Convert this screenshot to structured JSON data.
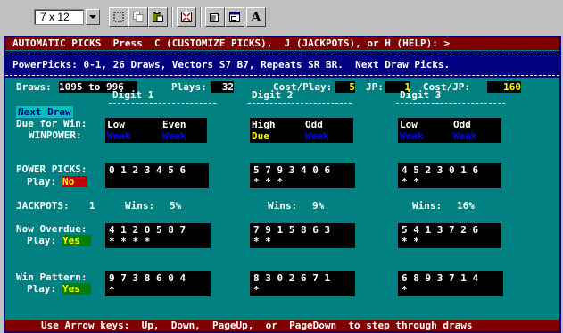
{
  "toolbar": {
    "font_size": "7 x 12",
    "letter_button": "A",
    "icons": [
      "select-icon",
      "copy-icon",
      "paste-icon",
      "fullscreen-icon",
      "properties-icon",
      "background-icon",
      "font-icon"
    ]
  },
  "header": {
    "prompt": "AUTOMATIC PICKS  Press  C (CUSTOMIZE PICKS),  J (JACKPOTS), or H (HELP): >",
    "summary": "PowerPicks: 0-1, 26 Draws, Vectors S7 B7, Repeats SR BR.  Next Draw Picks."
  },
  "stats": {
    "draws_label": "Draws:",
    "draws_value": "1095 to 996",
    "plays_label": "Plays:",
    "plays_value": "32",
    "cost_play_label": "Cost/Play:",
    "cost_play_value": "5",
    "jp_label": "JP:",
    "jp_value": "1",
    "cost_jp_label": "Cost/JP:",
    "cost_jp_value": "160"
  },
  "columns": [
    "Digit 1",
    "Digit 2",
    "Digit 3"
  ],
  "next_draw": "Next Draw",
  "due_label": "Due for Win:",
  "winpower_label": "WINPOWER:",
  "due": [
    {
      "a": "Low",
      "b": "Even",
      "wa": "Weak",
      "wb": "Weak",
      "wa_due": false
    },
    {
      "a": "High",
      "b": "Odd",
      "wa": "Due",
      "wb": "Weak",
      "wa_due": true
    },
    {
      "a": "Low",
      "b": "Odd",
      "wa": "Weak",
      "wb": "Weak",
      "wa_due": false
    }
  ],
  "power_picks": {
    "label": "POWER PICKS:",
    "play_label": "Play:",
    "play_value": "No",
    "values": [
      "0 1 2 3 4 5 6",
      "5 7 9 3 4 0 6",
      "4 5 2 3 0 1 6"
    ],
    "marks": [
      "",
      "* * *",
      "* *"
    ]
  },
  "jackpots": {
    "label": "JACKPOTS:",
    "count": "1",
    "wins_label": "Wins:",
    "wins": [
      "5%",
      "9%",
      "16%"
    ]
  },
  "now_overdue": {
    "label": "Now Overdue:",
    "play_label": "Play:",
    "play_value": "Yes",
    "values": [
      "4 1 2 0 5 8 7",
      "7 9 1 5 8 6 3",
      "5 4 1 3 7 2 6"
    ],
    "marks": [
      "* * * *",
      "* *",
      "* *"
    ]
  },
  "win_pattern": {
    "label": "Win Pattern:",
    "play_label": "Play:",
    "play_value": "Yes",
    "values": [
      "9 7 3 8 6 0 4",
      "8 3 0 2 6 7 1",
      "6 8 9 3 7 1 4"
    ],
    "marks": [
      "*",
      "*",
      "*"
    ]
  },
  "footer": "Use Arrow keys:  Up,  Down,  PageUp,  or  PageDown  to step through draws",
  "colors": {
    "terminal_bg": "#008080",
    "header_bar": "#800000",
    "info_bar": "#000080",
    "highlight": "#ffff00",
    "weak": "#0000ff"
  }
}
